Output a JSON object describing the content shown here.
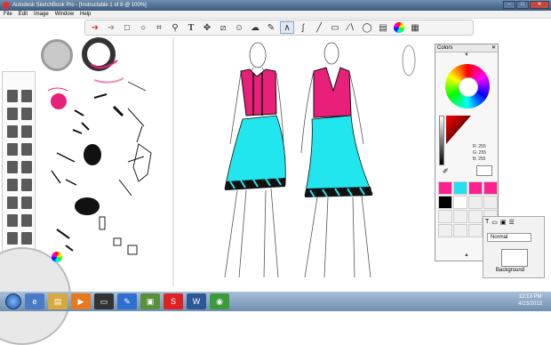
{
  "window": {
    "title": "Autodesk SketchBook Pro - [Instructable 1 of 8 @ 100%]",
    "buttons": {
      "minimize": "–",
      "maximize": "□",
      "close": "✕"
    }
  },
  "menu": [
    "File",
    "Edit",
    "Image",
    "Window",
    "Help"
  ],
  "toolbar": [
    "undo-icon",
    "redo-icon",
    "select-rect-icon",
    "lasso-icon",
    "crop-icon",
    "zoom-icon",
    "text-icon",
    "move-icon",
    "ruler-icon",
    "symmetry-icon",
    "shape-icon",
    "brush-icon",
    "curve-icon",
    "line-icon",
    "rect-icon",
    "polyline-icon",
    "ellipse-icon",
    "layer-icon",
    "color-wheel-icon",
    "brush-palette-icon"
  ],
  "colors_panel": {
    "title": "Colors",
    "close": "✕",
    "r_label": "R:",
    "r_value": "255",
    "g_label": "G:",
    "g_value": "255",
    "b_label": "B:",
    "b_value": "255",
    "swatches": [
      "#ff1f8e",
      "#22e0ee",
      "#ff1f8e",
      "#ff1f8e",
      "#000000",
      "#ffffff",
      "#eeeeee",
      "#eeeeee"
    ]
  },
  "layers_panel": {
    "blend_mode": "Normal",
    "layer_name": "Background"
  },
  "taskbar": {
    "time": "12:13 PM",
    "date": "4/23/2013"
  },
  "colors": {
    "pink": "#e8207a",
    "cyan": "#22e6ee",
    "black": "#111111"
  }
}
